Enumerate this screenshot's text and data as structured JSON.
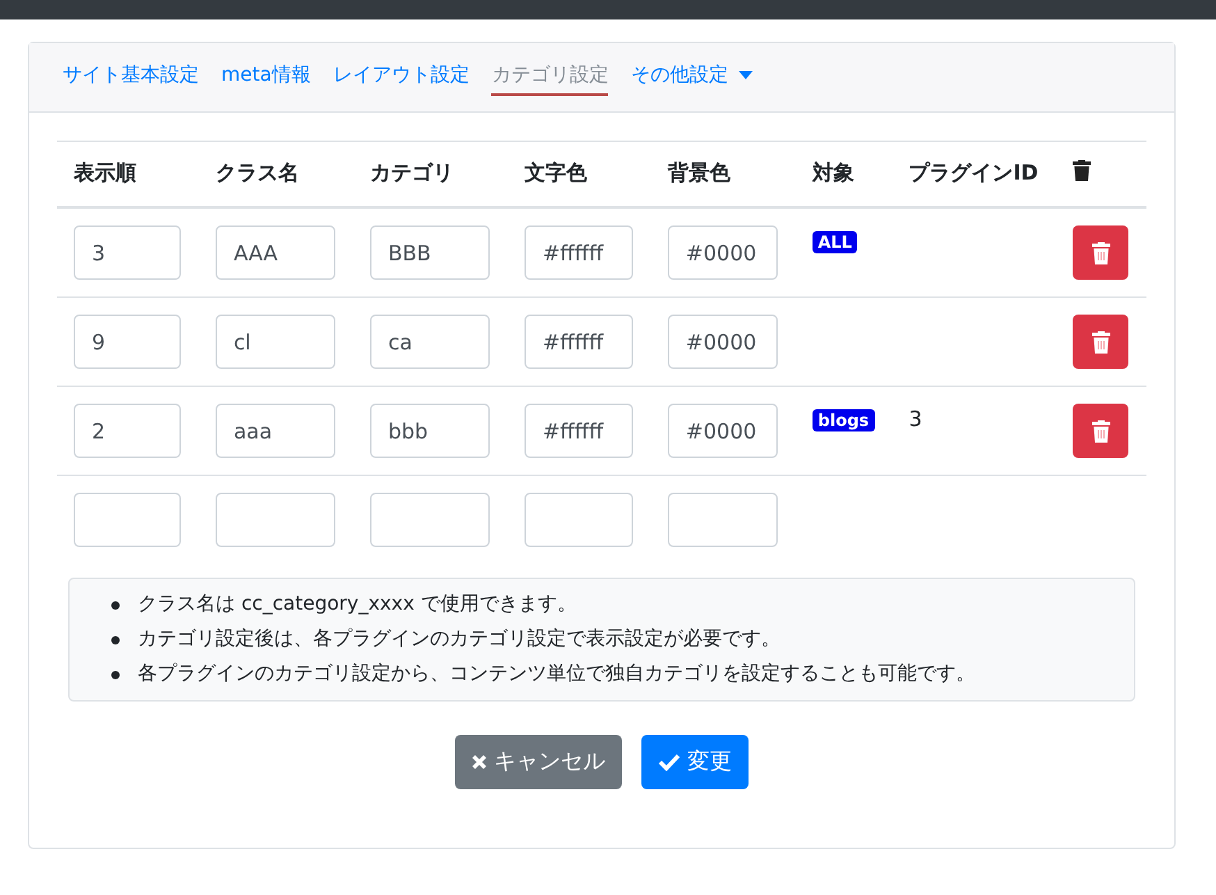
{
  "tabs": [
    {
      "label": "サイト基本設定",
      "selected": false,
      "dropdown": false
    },
    {
      "label": "meta情報",
      "selected": false,
      "dropdown": false
    },
    {
      "label": "レイアウト設定",
      "selected": false,
      "dropdown": false
    },
    {
      "label": "カテゴリ設定",
      "selected": true,
      "dropdown": false
    },
    {
      "label": "その他設定",
      "selected": false,
      "dropdown": true
    }
  ],
  "table": {
    "columns": [
      "表示順",
      "クラス名",
      "カテゴリ",
      "文字色",
      "背景色",
      "対象",
      "プラグインID"
    ],
    "rows": [
      {
        "kind": "existing",
        "fields": [
          "3",
          "AAA",
          "BBB",
          "#ffffff",
          "#0000"
        ],
        "target": "ALL"
      },
      {
        "kind": "existing",
        "fields": [
          "9",
          "cl",
          "ca",
          "#ffffff",
          "#0000"
        ]
      },
      {
        "kind": "existing",
        "fields": [
          "2",
          "aaa",
          "bbb",
          "#ffffff",
          "#0000"
        ],
        "target": "blogs",
        "plugin_id": "3"
      },
      {
        "kind": "new"
      }
    ]
  },
  "notes": [
    "クラス名は cc_category_xxxx で使用できます。",
    "カテゴリ設定後は、各プラグインのカテゴリ設定で表示設定が必要です。",
    "各プラグインのカテゴリ設定から、コンテンツ単位で独自カテゴリを設定することも可能です。"
  ],
  "buttons": [
    {
      "kind": "cancel",
      "label": "キャンセル"
    },
    {
      "kind": "submit",
      "label": "変更"
    }
  ]
}
